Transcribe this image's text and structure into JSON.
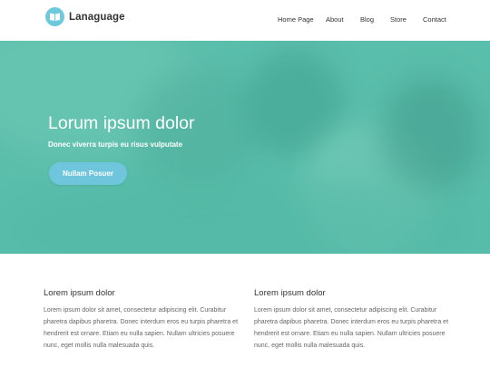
{
  "brand": {
    "name": "Lanaguage",
    "logo_icon": "open-book-icon",
    "accent": "#6fc9dd"
  },
  "nav": {
    "items": [
      {
        "label": "Home Page"
      },
      {
        "label": "About"
      },
      {
        "label": "Blog"
      },
      {
        "label": "Store"
      },
      {
        "label": "Contact"
      }
    ]
  },
  "hero": {
    "title": "Lorum ipsum dolor",
    "subtitle": "Donec viverra turpis eu risus vulputate",
    "button_label": "Nullam Posuer",
    "overlay_color": "#5cbdab",
    "button_color": "#6fc6dc"
  },
  "content": {
    "columns": [
      {
        "title": "Lorem ipsum dolor",
        "body": "Lorem ipsum dolor sit amet, consectetur adipiscing elit. Curabitur pharetra dapibus pharetra. Donec interdum eros eu turpis pharetra et hendrerit est ornare. Etiam eu nulla sapien. Nullam ultricies posuere nunc, eget mollis nulla malesuada quis."
      },
      {
        "title": "Lorem ipsum dolor",
        "body": "Lorem ipsum dolor sit amet, consectetur adipiscing elit. Curabitur pharetra dapibus pharetra. Donec interdum eros eu turpis pharetra et hendrerit est ornare. Etiam eu nulla sapien. Nullam ultricies posuere nunc, eget mollis nulla malesuada quis."
      }
    ]
  }
}
